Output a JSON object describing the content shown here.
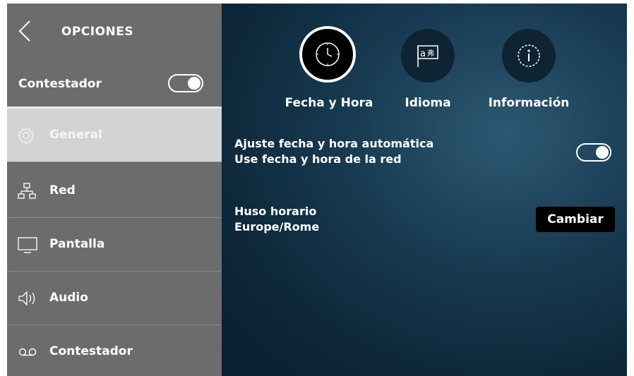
{
  "sidebar": {
    "title": "OPCIONES",
    "back_icon": "chevron-left-icon",
    "contestador_label": "Contestador",
    "contestador_toggle_on": true,
    "items": [
      {
        "label": "General",
        "icon": "gear-icon",
        "active": true
      },
      {
        "label": "Red",
        "icon": "network-icon",
        "active": false
      },
      {
        "label": "Pantalla",
        "icon": "monitor-icon",
        "active": false
      },
      {
        "label": "Audio",
        "icon": "speaker-icon",
        "active": false
      },
      {
        "label": "Contestador",
        "icon": "voicemail-icon",
        "active": false
      }
    ]
  },
  "tabs": [
    {
      "label": "Fecha y Hora",
      "icon": "clock-icon",
      "selected": true
    },
    {
      "label": "Idioma",
      "icon": "language-flag-icon",
      "selected": false
    },
    {
      "label": "Información",
      "icon": "info-icon",
      "selected": false
    }
  ],
  "settings": {
    "auto_datetime": {
      "title": "Ajuste fecha y hora automática",
      "subtitle": "Use fecha y hora de la red",
      "enabled": true
    },
    "timezone": {
      "title": "Huso horario",
      "value": "Europe/Rome",
      "button_label": "Cambiar"
    }
  },
  "colors": {
    "sidebar_bg": "#6c6c6c",
    "active_item_bg": "#d2d2d2",
    "main_bg": "#173a51",
    "button_bg": "#000000"
  }
}
